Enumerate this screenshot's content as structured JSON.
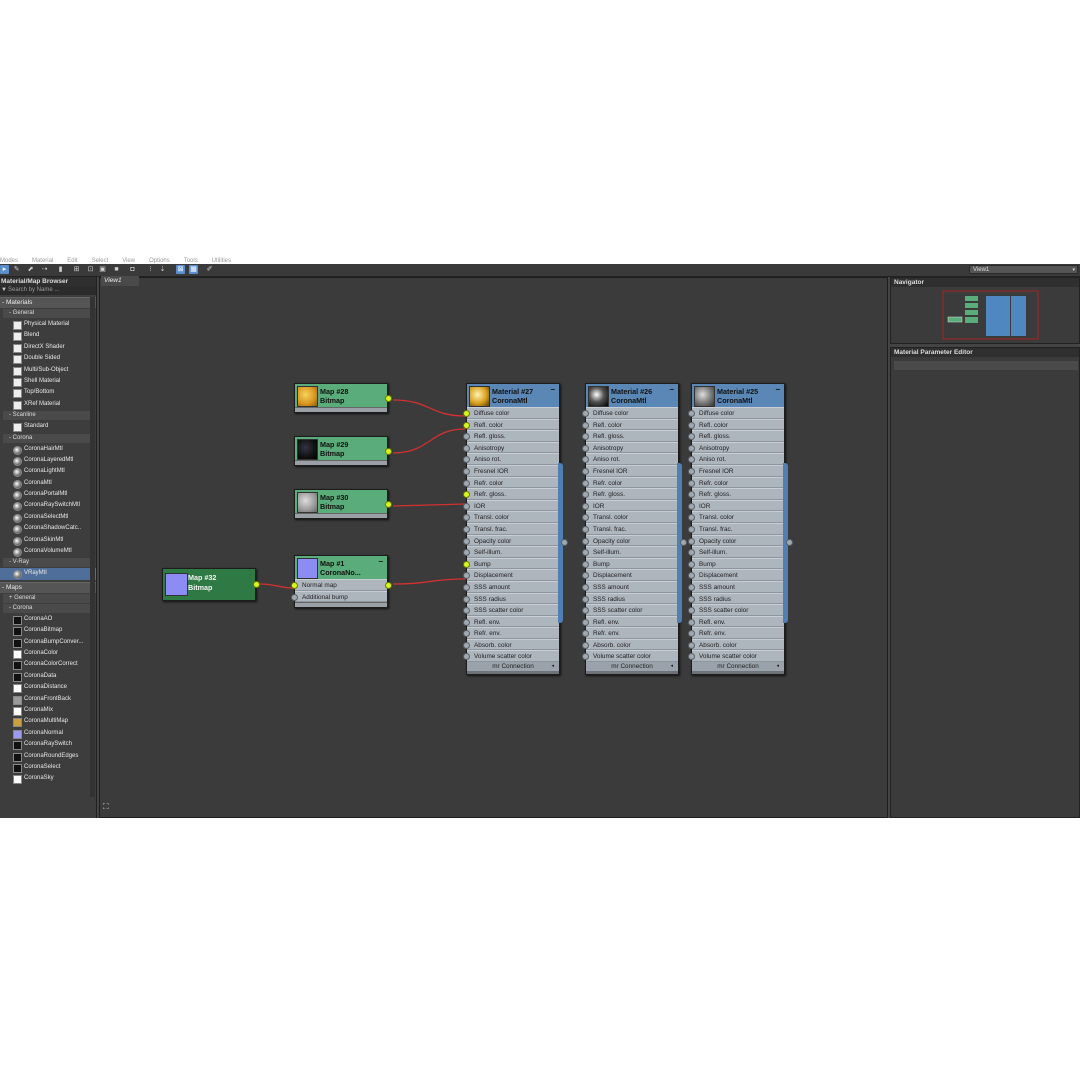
{
  "menubar": [
    "Modes",
    "Material",
    "Edit",
    "Select",
    "View",
    "Options",
    "Tools",
    "Utilities"
  ],
  "toolbar": {
    "icons": [
      "select-icon",
      "pick-icon",
      "put-icon",
      "assign-icon",
      "delete-icon",
      "bg-icon",
      "sample-icon",
      "layout-icon",
      "layout-icon-2",
      "show-map-icon",
      "parent-icon",
      "child-icon",
      "zoom-icon",
      "nav-icon",
      "lock-icon"
    ],
    "view_select": "View1",
    "chevron": "▾"
  },
  "browser": {
    "title": "Material/Map Browser",
    "search_placeholder": "Search by Name ...",
    "materials_header": "- Materials",
    "general_header": "- General",
    "general_items": [
      "Physical Material",
      "Blend",
      "DirectX Shader",
      "Double Sided",
      "Multi/Sub-Object",
      "Shell Material",
      "Top/Bottom",
      "XRef Material"
    ],
    "scanline_header": "- Scanline",
    "scanline_items": [
      "Standard"
    ],
    "corona_header": "- Corona",
    "corona_items": [
      "CoronaHairMtl",
      "CoronaLayeredMtl",
      "CoronaLightMtl",
      "CoronaMtl",
      "CoronaPortalMtl",
      "CoronaRaySwitchMtl",
      "CoronaSelectMtl",
      "CoronaShadowCatc..",
      "CoronaSkinMtl",
      "CoronaVolumeMtl"
    ],
    "vray_header": "- V-Ray",
    "vray_items": [
      "VRayMtl"
    ],
    "maps_header": "- Maps",
    "maps_general_header": "+ General",
    "maps_corona_header": "- Corona",
    "maps_corona_items": [
      {
        "label": "CoronaAO",
        "color": "#111111"
      },
      {
        "label": "CoronaBitmap",
        "color": "#111111"
      },
      {
        "label": "CoronaBumpConver...",
        "color": "#111111"
      },
      {
        "label": "CoronaColor",
        "color": "#ffffff"
      },
      {
        "label": "CoronaColorCorrect",
        "color": "#111111"
      },
      {
        "label": "CoronaData",
        "color": "#111111"
      },
      {
        "label": "CoronaDistance",
        "color": "#ffffff"
      },
      {
        "label": "CoronaFrontBack",
        "color": "#9a9a9a"
      },
      {
        "label": "CoronaMix",
        "color": "#ffffff"
      },
      {
        "label": "CoronaMultiMap",
        "color": "#c8a040"
      },
      {
        "label": "CoronaNormal",
        "color": "#9b9bf0"
      },
      {
        "label": "CoronaRaySwitch",
        "color": "#111111"
      },
      {
        "label": "CoronaRoundEdges",
        "color": "#111111"
      },
      {
        "label": "CoronaSelect",
        "color": "#111111"
      },
      {
        "label": "CoronaSky",
        "color": "#ffffff"
      }
    ]
  },
  "view": {
    "tab": "View1"
  },
  "nodes": {
    "map28": {
      "title": "Map #28",
      "type": "Bitmap"
    },
    "map29": {
      "title": "Map #29",
      "type": "Bitmap"
    },
    "map30": {
      "title": "Map #30",
      "type": "Bitmap"
    },
    "map32": {
      "title": "Map #32",
      "type": "Bitmap"
    },
    "map1": {
      "title": "Map #1",
      "type": "CoronaNo...",
      "slots": [
        "Normal map",
        "Additional bump"
      ]
    },
    "mat27": {
      "title": "Material #27",
      "type": "CoronaMtl"
    },
    "mat26": {
      "title": "Material #26",
      "type": "CoronaMtl"
    },
    "mat25": {
      "title": "Material #25",
      "type": "CoronaMtl"
    }
  },
  "material_slots": [
    "Diffuse color",
    "Refl. color",
    "Refl. gloss.",
    "Anisotropy",
    "Aniso rot.",
    "Fresnel IOR",
    "Refr. color",
    "Refr. gloss.",
    "IOR",
    "Transl. color",
    "Transl. frac.",
    "Opacity color",
    "Self-illum.",
    "Bump",
    "Displacement",
    "SSS amount",
    "SSS radius",
    "SSS scatter color",
    "Refl. env.",
    "Refr. env.",
    "Absorb. color",
    "Volume scatter color"
  ],
  "mr_connection": "mr Connection",
  "navigator": {
    "title": "Navigator"
  },
  "param_editor": {
    "title": "Material Parameter Editor"
  },
  "colors": {
    "map_node": "#5aac7a",
    "map32_node": "#2f7a44",
    "material_node": "#5a87b5",
    "wire": "#d33030",
    "active_port": "#d7f520"
  }
}
